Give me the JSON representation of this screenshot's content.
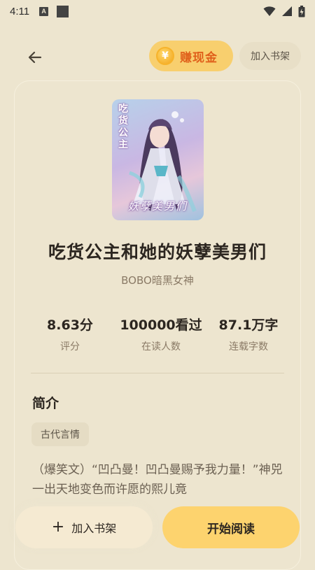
{
  "status_bar": {
    "time": "4:11",
    "notif_letter": "A",
    "icons": [
      "wifi-icon",
      "signal-icon",
      "battery-icon"
    ]
  },
  "header": {
    "earn_label": "赚现金",
    "coin_symbol": "¥",
    "add_shelf_label": "加入书架"
  },
  "book": {
    "cover_title_vertical": "吃货公主",
    "cover_title_script": "妖孽美男们",
    "title": "吃货公主和她的妖孽美男们",
    "author": "BOBO暗黑女神"
  },
  "stats": [
    {
      "value": "8.63分",
      "label": "评分"
    },
    {
      "value": "100000看过",
      "label": "在读人数"
    },
    {
      "value": "87.1万字",
      "label": "连载字数"
    }
  ],
  "intro": {
    "heading": "简介",
    "tag": "古代言情",
    "text": "（爆笑文）“凹凸曼！凹凸曼赐予我力量！”神兕一出天地变色而许愿的熙儿竟"
  },
  "bottom": {
    "add_label": "加入书架",
    "plus": "+",
    "start_label": "开始阅读"
  },
  "colors": {
    "background": "#ede5cf",
    "accent_yellow": "#fdd36e",
    "earn_text": "#e0601b"
  }
}
